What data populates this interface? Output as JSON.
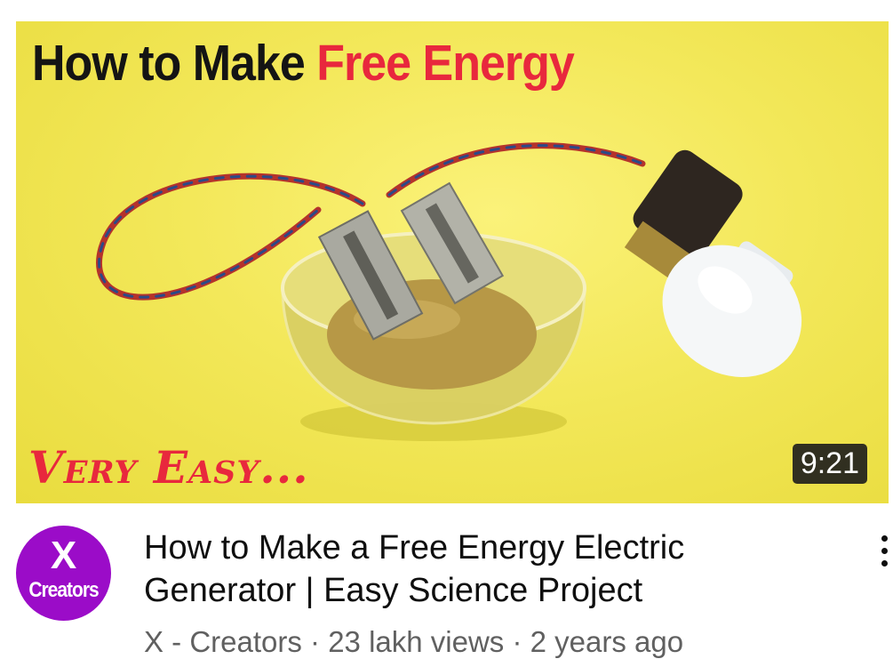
{
  "thumbnail": {
    "title_prefix": "How to Make ",
    "title_highlight": "Free Energy",
    "tagline": "Very Easy...",
    "duration": "9:21"
  },
  "channel": {
    "avatar_mark": "X",
    "avatar_name": "Creators",
    "name": "X - Creators"
  },
  "video": {
    "title": "How to Make a Free Energy Electric Generator | Easy Science Project",
    "separator": " · ",
    "views": "23 lakh views",
    "age": "2 years ago"
  },
  "colors": {
    "thumbnail_background": "#f3e85a",
    "highlight_red": "#e8283d",
    "avatar_purple": "#9b0cc8",
    "duration_badge": "#1c1c1c",
    "meta_gray": "#606060"
  },
  "icons": {
    "more": "more-vert-icon"
  }
}
